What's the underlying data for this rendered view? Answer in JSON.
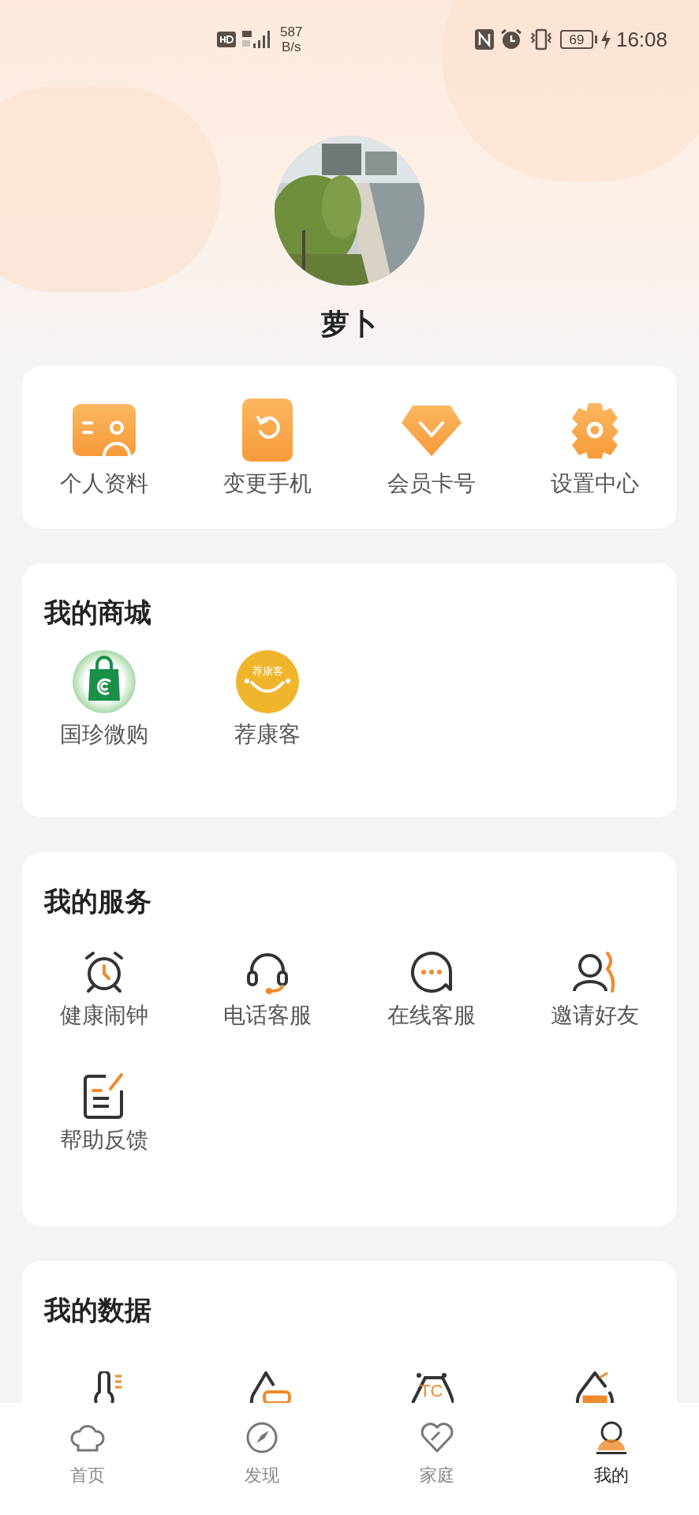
{
  "status_bar": {
    "speed_value": "587",
    "speed_unit": "B/s",
    "battery": "69",
    "time": "16:08"
  },
  "profile": {
    "name": "萝卜"
  },
  "quick_actions": [
    {
      "label": "个人资料",
      "kind": "card"
    },
    {
      "label": "变更手机",
      "kind": "phone"
    },
    {
      "label": "会员卡号",
      "kind": "gem"
    },
    {
      "label": "设置中心",
      "kind": "gear"
    }
  ],
  "sections": [
    {
      "title": "我的商城",
      "items": [
        {
          "label": "国珍微购",
          "kind": "bag"
        },
        {
          "label": "荐康客",
          "kind": "smile",
          "icon_text": "荐康客"
        }
      ]
    },
    {
      "title": "我的服务",
      "items": [
        {
          "label": "健康闹钟",
          "kind": "alarm"
        },
        {
          "label": "电话客服",
          "kind": "headset"
        },
        {
          "label": "在线客服",
          "kind": "chat"
        },
        {
          "label": "邀请好友",
          "kind": "invite"
        },
        {
          "label": "帮助反馈",
          "kind": "feedback"
        }
      ]
    },
    {
      "title": "我的数据",
      "items": [
        {
          "kind": "thermo"
        },
        {
          "kind": "drop"
        },
        {
          "kind": "hex",
          "icon_text": "TC"
        },
        {
          "kind": "drop2"
        }
      ]
    }
  ],
  "bottom_nav": [
    {
      "label": "首页",
      "kind": "chef",
      "selected": false
    },
    {
      "label": "发现",
      "kind": "compass",
      "selected": false
    },
    {
      "label": "家庭",
      "kind": "heart",
      "selected": false
    },
    {
      "label": "我的",
      "kind": "me",
      "selected": true
    }
  ]
}
